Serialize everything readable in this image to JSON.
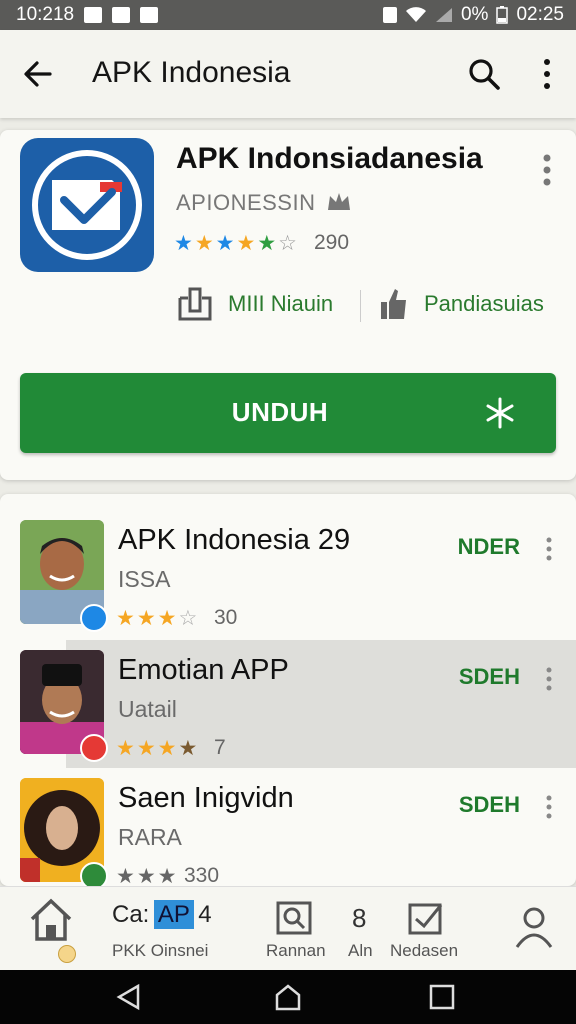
{
  "status": {
    "time": "10:218",
    "battery_text": "0%",
    "clock_right": "02:25"
  },
  "appbar": {
    "title": "APK Indonesia",
    "back_icon": "arrow-back-icon",
    "search_icon": "search-icon",
    "more_icon": "more-vert-icon"
  },
  "hero": {
    "app_name": "APK Indonsiadanesia",
    "developer": "APIONESSIN",
    "rating_count": "290",
    "meta_left": "MIII Niauin",
    "meta_right": "Pandiasuias",
    "install_label": "UNDUH",
    "colors": {
      "install": "#218a37",
      "icon_bg": "#1d5fa8"
    }
  },
  "list": [
    {
      "name": "APK Indonesia 29",
      "sub": "ISSA",
      "stars": 3,
      "count": "30",
      "action": "NDER",
      "badge": "#1e88e5"
    },
    {
      "name": "Emotian APP",
      "sub": "Uatail",
      "stars": 3.5,
      "count": "7",
      "action": "SDEH",
      "badge": "#e53935"
    },
    {
      "name": "Saen Inigvidn",
      "sub": "RARA",
      "stars": 3,
      "count": "330",
      "action": "SDEH",
      "badge": "#2e8b3a"
    }
  ],
  "bottomnav": {
    "tab1_top": "Ca:",
    "tab1_highlight": "AP",
    "tab1_num": "4",
    "tab1_sub": "PKK Oinsnei",
    "tab2_label": "Rannan",
    "tab3_num": "8",
    "tab3_label": "Aln",
    "tab4_label": "Nedasen"
  }
}
